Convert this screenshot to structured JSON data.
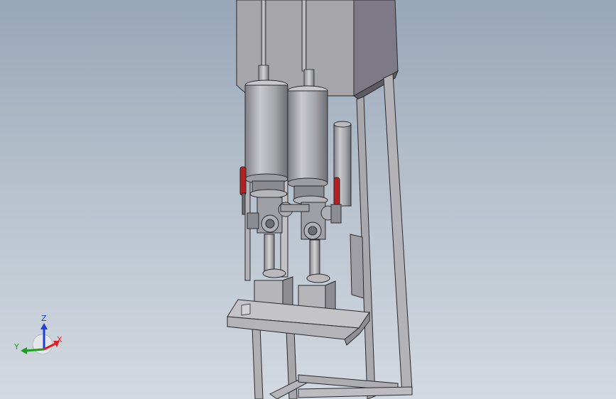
{
  "viewport": {
    "background_top": "#97a6b8",
    "background_bottom": "#d3d9e0",
    "model_color": "#a9a9ad",
    "edge_color": "#2a2a2e",
    "valve_handle_color": "#b22222"
  },
  "triad": {
    "x_label": "X",
    "y_label": "Y",
    "z_label": "Z",
    "x_color": "#e02020",
    "y_color": "#19a019",
    "z_color": "#1f3fd8"
  }
}
